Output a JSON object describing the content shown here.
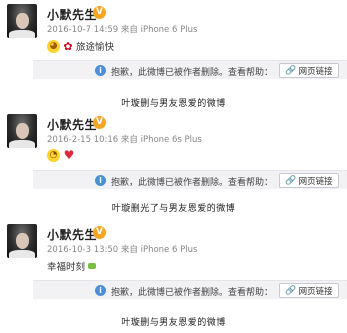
{
  "posts": [
    {
      "username": "小默先生",
      "verified_badge": "V",
      "timestamp": "2016-10-7 14:59",
      "source": "来自 iPhone 6 Plus",
      "text": "旅途愉快",
      "emojis": [
        "laugh-emoji",
        "rose-emoji"
      ]
    },
    {
      "username": "小默先生",
      "verified_badge": "V",
      "timestamp": "2016-2-15 10:16",
      "source": "来自 iPhone 6s Plus",
      "text": "",
      "emojis": [
        "blush-emoji",
        "heart-emoji"
      ]
    },
    {
      "username": "小默先生",
      "verified_badge": "V",
      "timestamp": "2016-10-3 13:50",
      "source": "来自 iPhone 6 Plus",
      "text": "幸福时刻",
      "emojis": [
        "small-sticker-emoji"
      ]
    }
  ],
  "deleted_notice": {
    "info_icon": "i",
    "message": "抱歉，此微博已被作者删除。查看帮助：",
    "link_label": "网页链接",
    "link_icon": "link-icon"
  },
  "captions": [
    "叶璇删与男友恩爱的微博",
    "叶璇删光了与男友恩爱的微博",
    "叶璇删与男友恩爱的微博"
  ],
  "colors": {
    "verified": "#f5a623",
    "info_blue": "#4d8ed3",
    "bar_bg": "#f2f2f5"
  }
}
